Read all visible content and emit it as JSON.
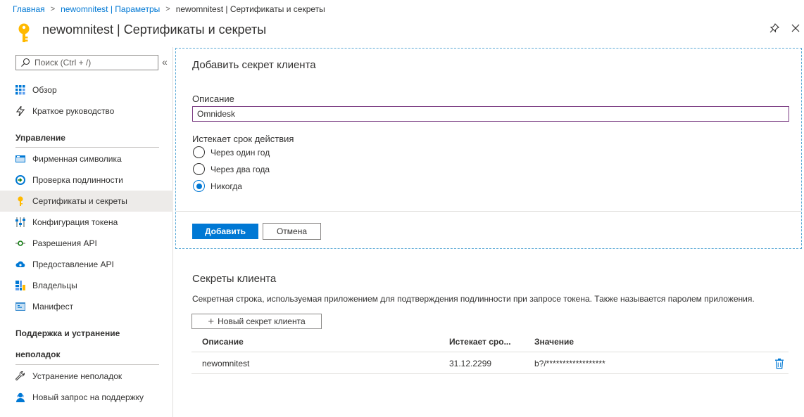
{
  "breadcrumb": {
    "items": [
      "Главная",
      "newomnitest | Параметры"
    ],
    "current": "newomnitest | Сертификаты и секреты"
  },
  "header": {
    "title": "newomnitest | Сертификаты и секреты",
    "icon": "key-icon"
  },
  "sidebar": {
    "search_placeholder": "Поиск (Ctrl + /)",
    "collapse_glyph": "«",
    "top_items": [
      {
        "label": "Обзор",
        "icon": "grid-icon"
      },
      {
        "label": "Краткое руководство",
        "icon": "lightning-icon"
      }
    ],
    "section_manage": "Управление",
    "manage_items": [
      {
        "label": "Фирменная символика",
        "icon": "branding-icon"
      },
      {
        "label": "Проверка подлинности",
        "icon": "authentication-icon"
      },
      {
        "label": "Сертификаты и секреты",
        "icon": "key-icon"
      },
      {
        "label": "Конфигурация токена",
        "icon": "sliders-icon"
      },
      {
        "label": "Разрешения API",
        "icon": "api-permission-icon"
      },
      {
        "label": "Предоставление API",
        "icon": "cloud-icon"
      },
      {
        "label": "Владельцы",
        "icon": "owners-icon"
      },
      {
        "label": "Манифест",
        "icon": "manifest-icon"
      }
    ],
    "section_support_line1": "Поддержка и устранение",
    "section_support_line2": "неполадок",
    "support_items": [
      {
        "label": "Устранение неполадок",
        "icon": "wrench-icon"
      },
      {
        "label": "Новый запрос на поддержку",
        "icon": "support-person-icon"
      }
    ]
  },
  "add_secret": {
    "title": "Добавить секрет клиента",
    "description_label": "Описание",
    "description_value": "Omnidesk",
    "expires_label": "Истекает срок действия",
    "options": [
      "Через один год",
      "Через два года",
      "Никогда"
    ],
    "selected": "Никогда",
    "add_button": "Добавить",
    "cancel_button": "Отмена"
  },
  "secrets": {
    "title": "Секреты клиента",
    "description": "Секретная строка, используемая приложением для подтверждения подлинности при запросе токена. Также называется паролем приложения.",
    "new_button": "Новый секрет клиента",
    "columns": [
      "Описание",
      "Истекает сро...",
      "Значение"
    ],
    "rows": [
      {
        "description": "newomnitest",
        "expires": "31.12.2299",
        "value": "b?/******************"
      }
    ]
  },
  "colors": {
    "accent": "#0078d4",
    "input_focus_border": "#7a3b82",
    "panel_border": "#5aa9d6",
    "key_yellow": "#ffb900"
  }
}
